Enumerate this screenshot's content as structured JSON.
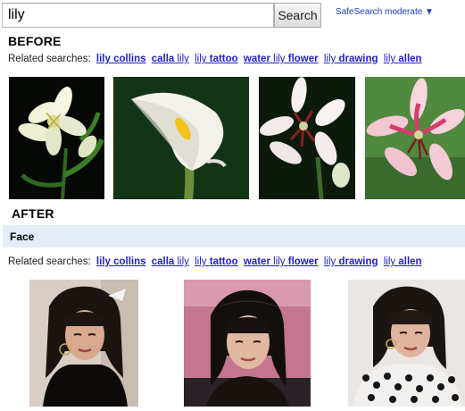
{
  "search": {
    "query": "lily",
    "button_label": "Search",
    "safesearch_label": "SafeSearch moderate ▼"
  },
  "before": {
    "title": "BEFORE",
    "related_label": "Related searches:",
    "related": [
      {
        "normal": "",
        "bold": "lily collins"
      },
      {
        "normal": "",
        "bold": "calla",
        "rest": " lily"
      },
      {
        "normal": "lily ",
        "bold": "tattoo"
      },
      {
        "normal": "",
        "bold": "water",
        "rest": " lily ",
        "bold2": "flower"
      },
      {
        "normal": "lily ",
        "bold": "drawing"
      },
      {
        "normal": "lily ",
        "bold": "allen"
      }
    ],
    "images": [
      "white-lily-image",
      "calla-lily-image",
      "stargazer-lily-image",
      "pink-lily-image"
    ]
  },
  "after": {
    "title": "AFTER",
    "filter_label": "Face",
    "related_label": "Related searches:",
    "images": [
      "portrait-image-1",
      "portrait-image-2",
      "portrait-image-3"
    ]
  },
  "colors": {
    "link": "#2222cc",
    "face_bar": "#e5ecf9",
    "safesearch": "#1a3cc8"
  }
}
